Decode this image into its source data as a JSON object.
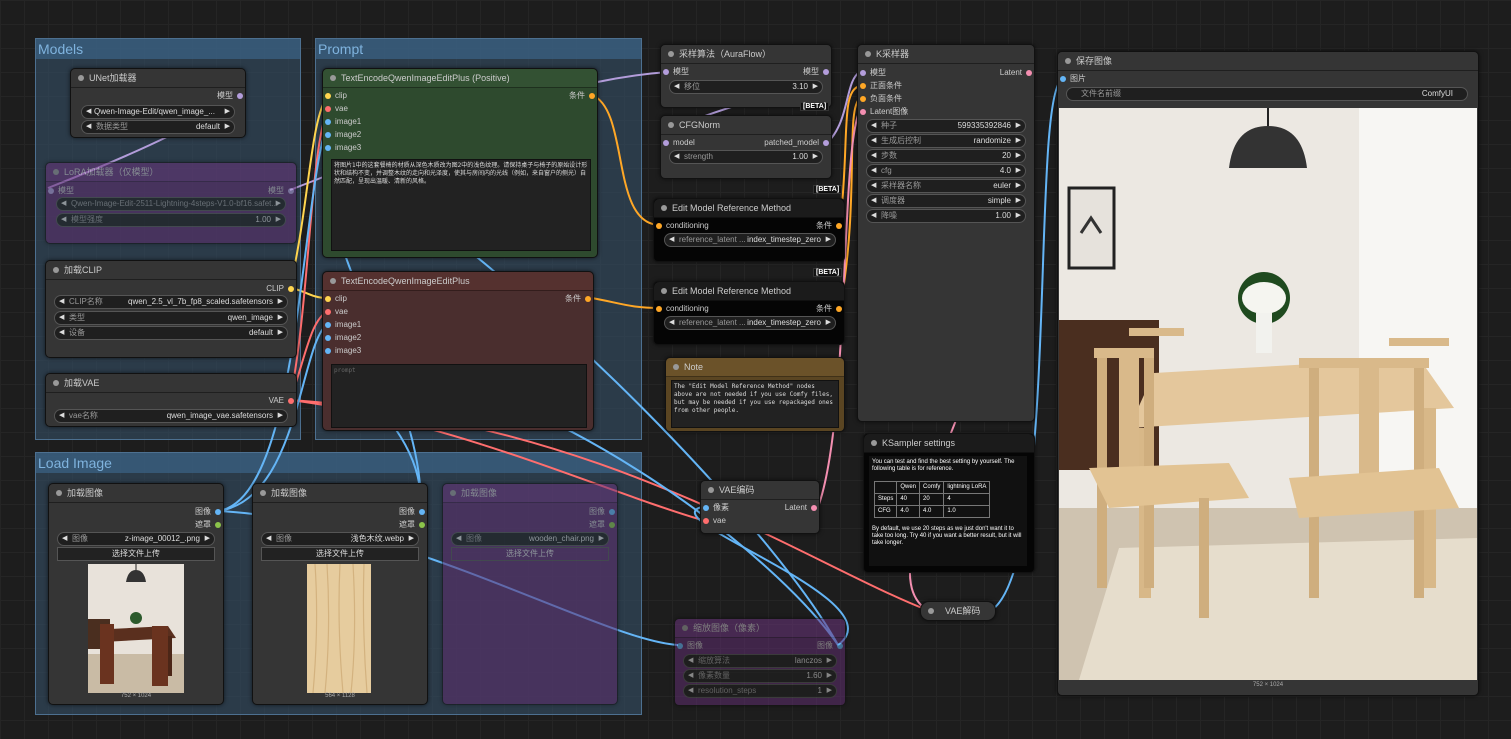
{
  "groups": {
    "models": "Models",
    "prompt": "Prompt",
    "load_image": "Load Image"
  },
  "unet": {
    "title": "UNet加载器",
    "out_model": "模型",
    "w1": "Qwen-Image-Edit/qwen_image_...",
    "w2_label": "数据类型",
    "w2_value": "default"
  },
  "lora": {
    "title": "LoRA加载器（仅模型）",
    "in_model": "模型",
    "out_model": "模型",
    "w1": "Qwen-Image-Edit-2511-Lightning-4steps-V1.0-bf16.safet...",
    "w2_label": "模型强度",
    "w2_value": "1.00"
  },
  "clip": {
    "title": "加载CLIP",
    "out": "CLIP",
    "w1_label": "CLIP名称",
    "w1_value": "qwen_2.5_vl_7b_fp8_scaled.safetensors",
    "w2_label": "类型",
    "w2_value": "qwen_image",
    "w3_label": "设备",
    "w3_value": "default"
  },
  "vae": {
    "title": "加载VAE",
    "out": "VAE",
    "w1_label": "vae名称",
    "w1_value": "qwen_image_vae.safetensors"
  },
  "pos": {
    "title": "TextEncodeQwenImageEditPlus (Positive)",
    "inputs": [
      "clip",
      "vae",
      "image1",
      "image2",
      "image3"
    ],
    "out": "条件",
    "text": "将图片1中的这套餐椅的材质从深色木质改为图2中的浅色纹理。请保持桌子与椅子的原始设计形状和结构不变，并调整木纹的走向和光泽度，使其与房间内的光线（例如，来自窗户的侧光）自然匹配，呈现出温暖、清新的风格。"
  },
  "neg": {
    "title": "TextEncodeQwenImageEditPlus",
    "inputs": [
      "clip",
      "vae",
      "image1",
      "image2",
      "image3"
    ],
    "out": "条件",
    "text": "prompt"
  },
  "aura": {
    "title": "采样算法（AuraFlow）",
    "in": "模型",
    "out": "模型",
    "w_label": "移位",
    "w_value": "3.10",
    "beta": "[BETA]"
  },
  "cfgnorm": {
    "title": "CFGNorm",
    "in": "model",
    "out": "patched_model",
    "w_label": "strength",
    "w_value": "1.00",
    "beta": "[BETA]"
  },
  "emr1": {
    "title": "Edit Model Reference Method",
    "in": "conditioning",
    "out": "条件",
    "w_label": "reference_latent ...",
    "w_value": "index_timestep_zero",
    "beta": "[BETA]"
  },
  "emr2": {
    "title": "Edit Model Reference Method",
    "in": "conditioning",
    "out": "条件",
    "w_label": "reference_latent ...",
    "w_value": "index_timestep_zero"
  },
  "note": {
    "title": "Note",
    "text": "The \"Edit Model Reference Method\" nodes above are not needed if you use Comfy files, but may be needed if you use repackaged ones from other people."
  },
  "ksampler": {
    "title": "K采样器",
    "inputs": [
      "模型",
      "正面条件",
      "负面条件",
      "Latent图像"
    ],
    "out": "Latent",
    "widgets": [
      [
        "种子",
        "599335392846"
      ],
      [
        "生成后控制",
        "randomize"
      ],
      [
        "步数",
        "20"
      ],
      [
        "cfg",
        "4.0"
      ],
      [
        "采样器名称",
        "euler"
      ],
      [
        "调度器",
        "simple"
      ],
      [
        "降噪",
        "1.00"
      ]
    ]
  },
  "ks_settings": {
    "title": "KSampler settings",
    "intro": "You can test and find the best setting by yourself. The following table is for reference.",
    "header": [
      "",
      "Qwen",
      "Comfy",
      "lightning LoRA"
    ],
    "rows": [
      [
        "Steps",
        "40",
        "20",
        "4"
      ],
      [
        "CFG",
        "4.0",
        "4.0",
        "1.0"
      ]
    ],
    "footer": "By default, we use 20 steps as we just don't want it to take too long. Try 40 if you want a better result, but it will take longer."
  },
  "save": {
    "title": "保存图像",
    "in": "图片",
    "w_label": "文件名前缀",
    "w_value": "ComfyUI",
    "caption": "752 × 1024"
  },
  "load1": {
    "title": "加载图像",
    "out1": "图像",
    "out2": "遮罩",
    "w_label": "图像",
    "w_value": "z-image_00012_.png",
    "btn": "选择文件上传",
    "caption": "752 × 1024"
  },
  "load2": {
    "title": "加载图像",
    "out1": "图像",
    "out2": "遮罩",
    "w_label": "图像",
    "w_value": "浅色木纹.webp",
    "btn": "选择文件上传",
    "caption": "564 × 1128"
  },
  "load3": {
    "title": "加载图像",
    "out1": "图像",
    "out2": "遮罩",
    "w_label": "图像",
    "w_value": "wooden_chair.png",
    "btn": "选择文件上传"
  },
  "vaeenc": {
    "title": "VAE编码",
    "in1": "像素",
    "in2": "vae",
    "out": "Latent"
  },
  "vaedec": {
    "title": "VAE解码"
  },
  "scale": {
    "title": "缩放图像（像素）",
    "in": "图像",
    "out": "图像",
    "w1_label": "缩放算法",
    "w1_value": "lanczos",
    "w2_label": "像素数量",
    "w2_value": "1.60",
    "w3_label": "resolution_steps",
    "w3_value": "1"
  }
}
